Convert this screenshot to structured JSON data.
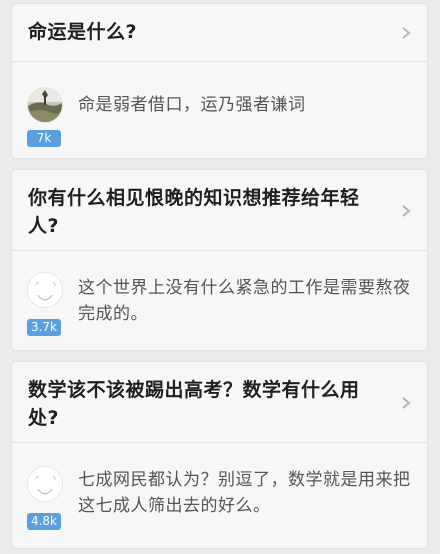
{
  "feed": [
    {
      "question": "命运是什么?",
      "answer": "命是弱者借口，运乃强者谦词",
      "votes": "7k",
      "avatar": "landscape-photo-avatar"
    },
    {
      "question": "你有什么相见恨晚的知识想推荐给年轻人?",
      "answer": "这个世界上没有什么紧急的工作是需要熬夜完成的。",
      "votes": "3.7k",
      "avatar": "sketch-avatar"
    },
    {
      "question": "数学该不该被踢出高考？数学有什么用处?",
      "answer": "七成网民都认为？别逗了，数学就是用来把这七成人筛出去的好么。",
      "votes": "4.8k",
      "avatar": "sketch-avatar"
    }
  ],
  "icons": {
    "chevron": "chevron-right-icon"
  },
  "colors": {
    "background": "#ebebeb",
    "card": "#f7f7f7",
    "title": "#1f1f1f",
    "answer": "#555555",
    "badge": "#5aa0de"
  }
}
